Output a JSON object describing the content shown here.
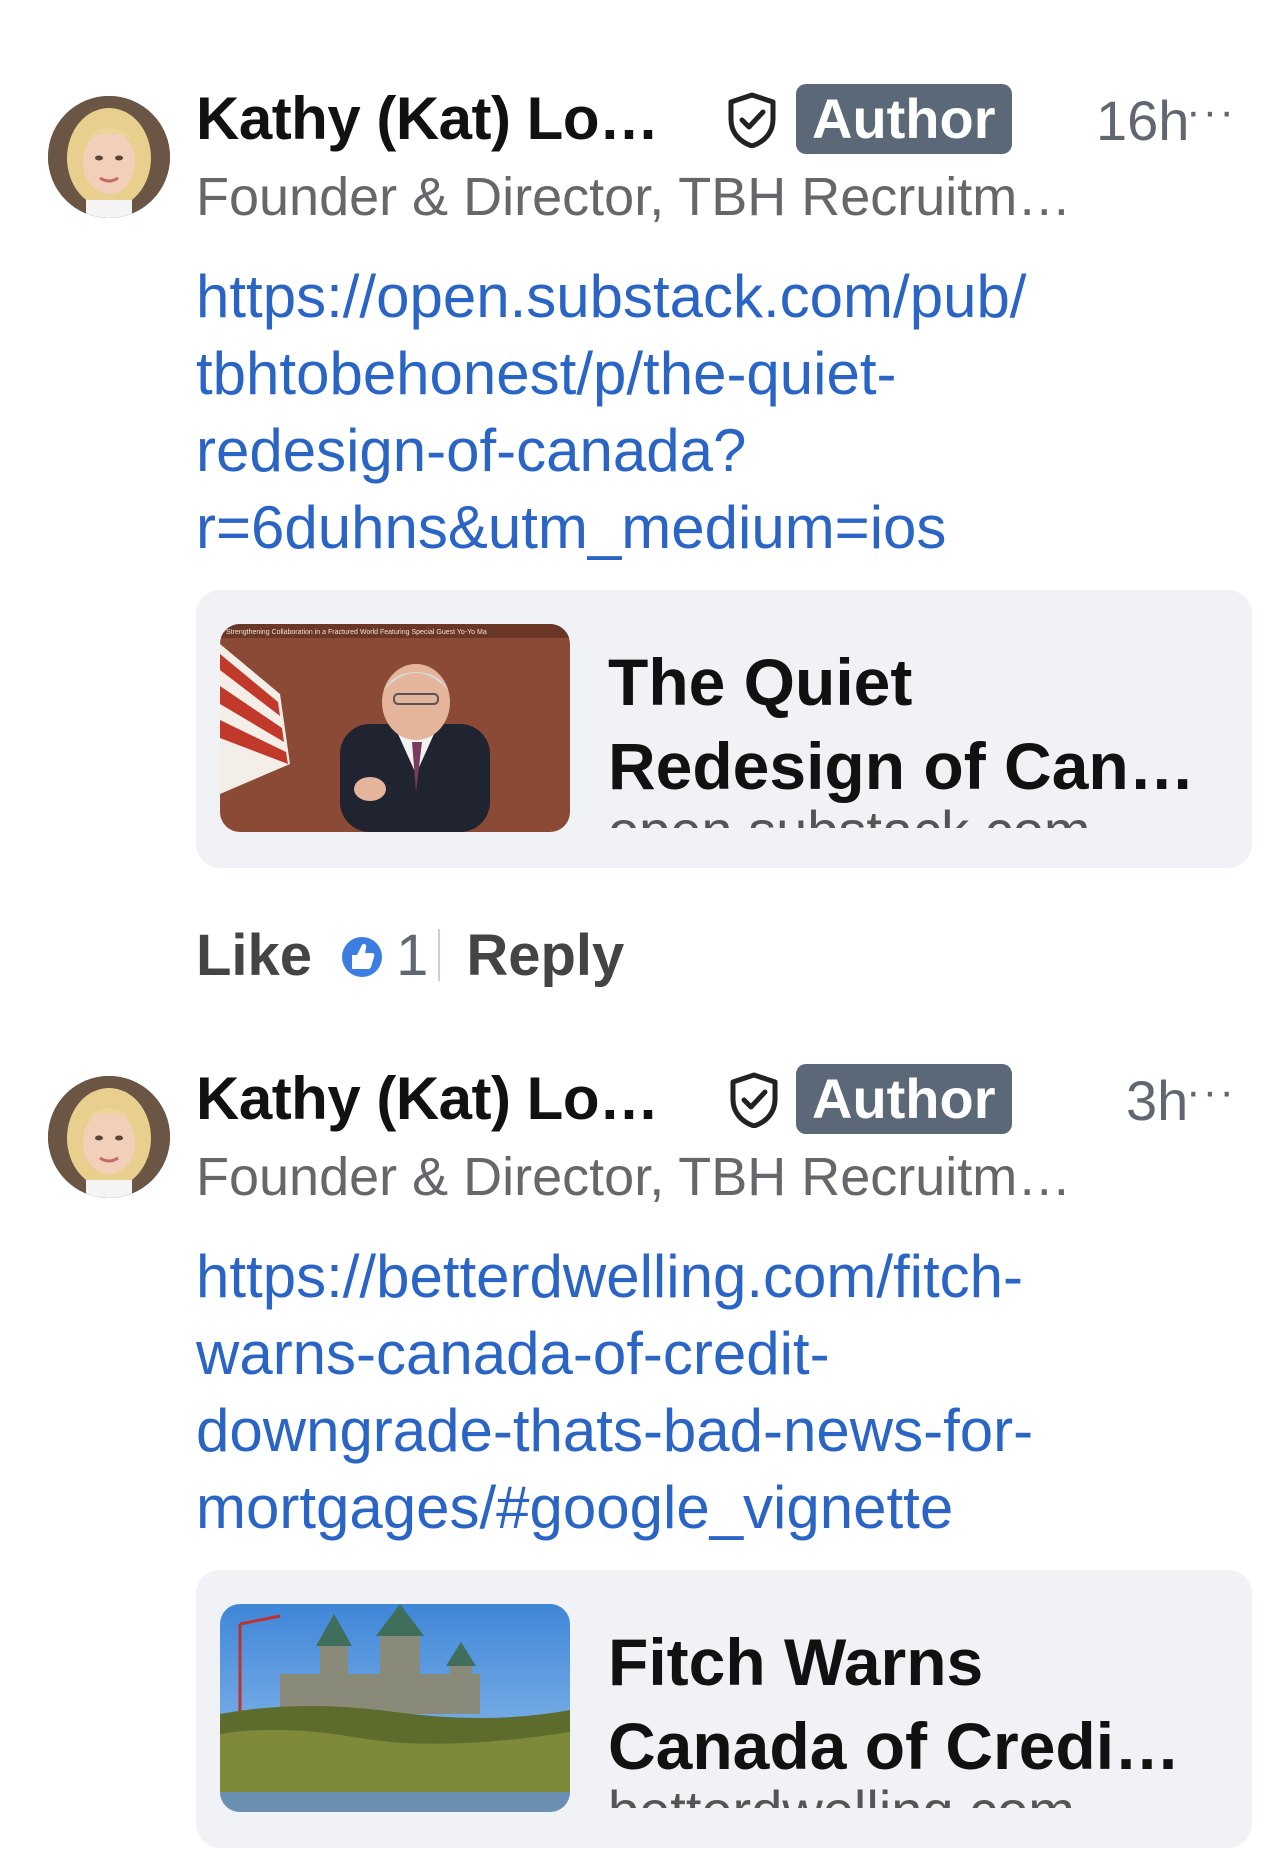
{
  "colors": {
    "link": "#2a64c5",
    "badge_bg": "#5b6878",
    "card_bg": "#f0f2f5",
    "like_icon": "#3b7de0"
  },
  "comments": [
    {
      "author_name": "Kathy (Kat) Lo…",
      "badge": "Author",
      "time": "16h",
      "more": "···",
      "subtitle": "Founder & Director, TBH Recruitm…",
      "link_lines": [
        "https://open.substack.com/pub/",
        "tbhtobehonest/p/the-quiet-",
        "redesign-of-canada?",
        "r=6duhns&utm_medium=ios"
      ],
      "card": {
        "title_lines": [
          "The Quiet",
          "Redesign of Can…"
        ],
        "domain": "open.substack.com",
        "thumb_icon": "video-still-speaker-thumbnail",
        "thumb_caption": "Strengthening Collaboration in a Fractured World Featuring Special Guest Yo-Yo Ma"
      },
      "like_label": "Like",
      "like_count": "1",
      "reply_label": "Reply"
    },
    {
      "author_name": "Kathy (Kat) Lo…",
      "badge": "Author",
      "time": "3h",
      "more": "···",
      "subtitle": "Founder & Director, TBH Recruitm…",
      "link_lines": [
        "https://betterdwelling.com/fitch-",
        "warns-canada-of-credit-",
        "downgrade-thats-bad-news-for-",
        "mortgages/#google_vignette"
      ],
      "card": {
        "title_lines": [
          "Fitch Warns",
          "Canada of Credi…"
        ],
        "domain": "betterdwelling.com",
        "thumb_icon": "parliament-hill-photo"
      }
    }
  ]
}
